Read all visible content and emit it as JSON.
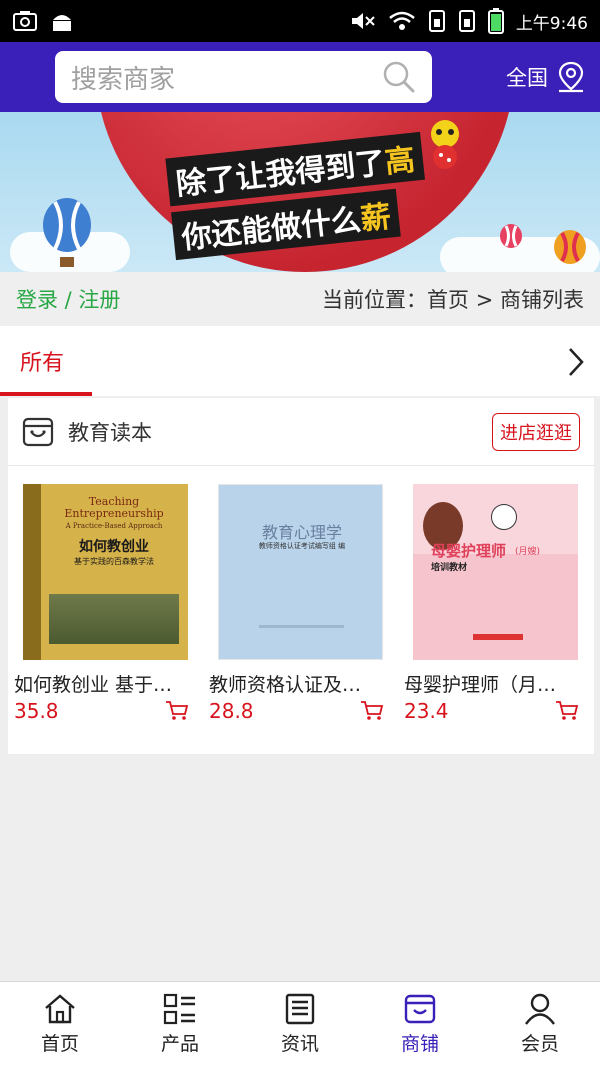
{
  "status_bar": {
    "time": "上午9:46"
  },
  "header": {
    "search_placeholder": "搜索商家",
    "region": "全国"
  },
  "banner": {
    "line1_prefix": "除了让我得到了",
    "line1_gold": "高",
    "line2_prefix": "你还能做什么",
    "line2_gold": "薪"
  },
  "login_bar": {
    "login_label": "登录 / 注册",
    "breadcrumb": "当前位置：首页 > 商铺列表"
  },
  "tabs": {
    "active": "所有"
  },
  "shop": {
    "name": "教育读本",
    "visit_label": "进店逛逛",
    "products": [
      {
        "title": "如何教创业 基于…",
        "price": "35.8",
        "cover_title_en": "Teaching Entrepreneurship",
        "cover_subtitle_en": "A Practice-Based Approach",
        "cover_title_cn": "如何教创业",
        "cover_sub_cn": "基于实践的百森教学法"
      },
      {
        "title": "教师资格认证及…",
        "price": "28.8",
        "cover_title_cn": "教育心理学",
        "cover_sub_cn": "教师资格认证考试编写组 编"
      },
      {
        "title": "母婴护理师（月…",
        "price": "23.4",
        "cover_title_cn": "母婴护理师",
        "cover_tag": "(月嫂)",
        "cover_sub_cn": "培训教材"
      }
    ]
  },
  "bottom_nav": [
    {
      "label": "首页",
      "icon": "home-icon"
    },
    {
      "label": "产品",
      "icon": "list-icon"
    },
    {
      "label": "资讯",
      "icon": "news-icon"
    },
    {
      "label": "商铺",
      "icon": "store-icon",
      "active": true
    },
    {
      "label": "会员",
      "icon": "user-icon"
    }
  ],
  "colors": {
    "brand": "#3a1fb8",
    "accent_red": "#d7141d",
    "login_green": "#28a745"
  }
}
